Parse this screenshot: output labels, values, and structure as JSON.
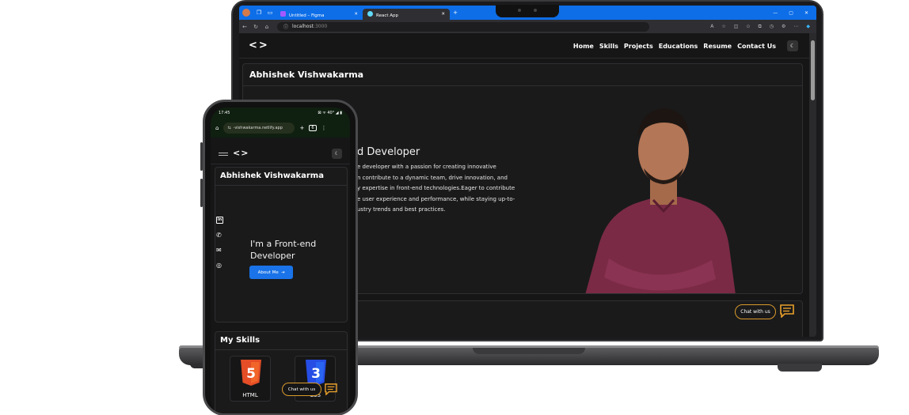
{
  "browser": {
    "tabs": [
      {
        "label": "Untitled – Figma",
        "close": "✕",
        "favicon_color": "#a259ff"
      },
      {
        "label": "React App",
        "close": "✕",
        "favicon_color": "#61dafb"
      }
    ],
    "new_tab": "+",
    "url_host": "localhost",
    "url_port": ":3000"
  },
  "site": {
    "logo": "<>",
    "nav": [
      "Home",
      "Skills",
      "Projects",
      "Educations",
      "Resume",
      "Contact Us"
    ],
    "theme_icon": "☾",
    "name": "Abhishek Vishwakarma",
    "role_partial": "d Developer",
    "desc_lines": [
      "e developer with a passion for creating innovative",
      "n contribute to a dynamic team, drive innovation, and",
      "y expertise in front-end technologies.Eager to contribute",
      "e user experience and performance, while staying up-to-",
      "ustry trends and best practices."
    ],
    "chat_label": "Chat with us"
  },
  "phone": {
    "time": "17:45",
    "status_icons": "⊠ ᯤ 40° ◢ ▮",
    "url": "-vishwakarma.netlify.app",
    "name": "Abhishek Vishwakarma",
    "role_line1": "I'm a Front-end",
    "role_line2": "Developer",
    "about_btn": "About Me",
    "skills_title": "My Skills",
    "skills": [
      {
        "label": "HTML",
        "glyph": "5",
        "color": "#e44d26"
      },
      {
        "label": "CSS",
        "glyph": "3",
        "color": "#264de4"
      }
    ],
    "chat_label": "Chat with us"
  },
  "colors": {
    "accent": "#1a73e8",
    "chat_border": "#d99b2b",
    "edge_tab_bar": "#0d6ee8"
  }
}
